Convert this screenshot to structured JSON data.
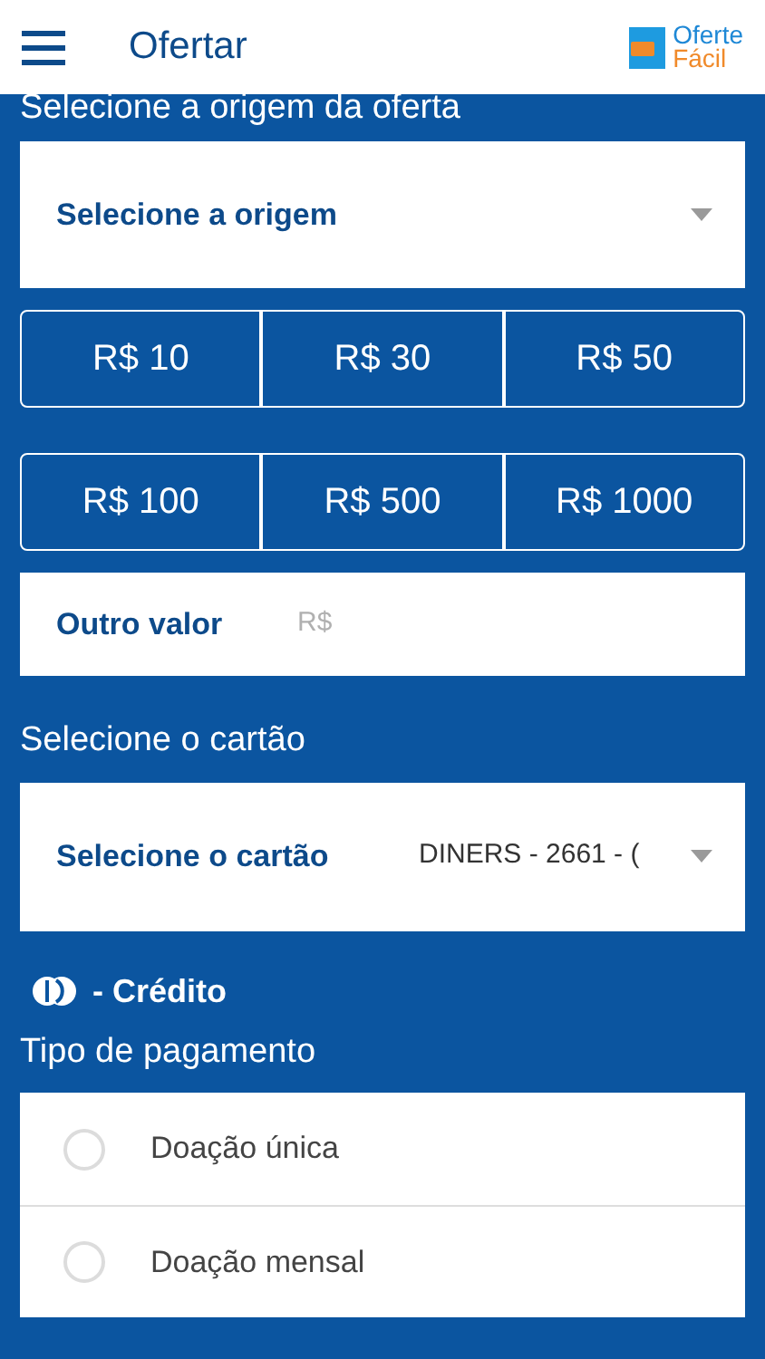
{
  "header": {
    "title": "Ofertar",
    "logo": {
      "line_1": "Oferte",
      "line_2": "Fácil"
    }
  },
  "origin": {
    "label": "Selecione a origem da oferta",
    "select": "Selecione a origem"
  },
  "amounts": [
    {
      "label": "R$ 10",
      "selected": false
    },
    {
      "label": "R$ 30",
      "selected": false
    },
    {
      "label": "R$ 50",
      "selected": false
    },
    {
      "label": "R$ 100",
      "selected": false
    },
    {
      "label": "R$ 500",
      "selected": false
    },
    {
      "label": "R$ 1000",
      "selected": false
    }
  ],
  "other_value": {
    "label": "Outro valor",
    "placeholder": "R$"
  },
  "card": {
    "label": "Selecione o cartão",
    "select_label": "Selecione o cartão",
    "value": "DINERS - 2661 - (",
    "type": "- Crédito"
  },
  "payment": {
    "label": "Tipo de pagamento",
    "options": [
      {
        "label": "Doação única",
        "selected": false
      },
      {
        "label": "Doação mensal",
        "selected": false
      }
    ]
  }
}
